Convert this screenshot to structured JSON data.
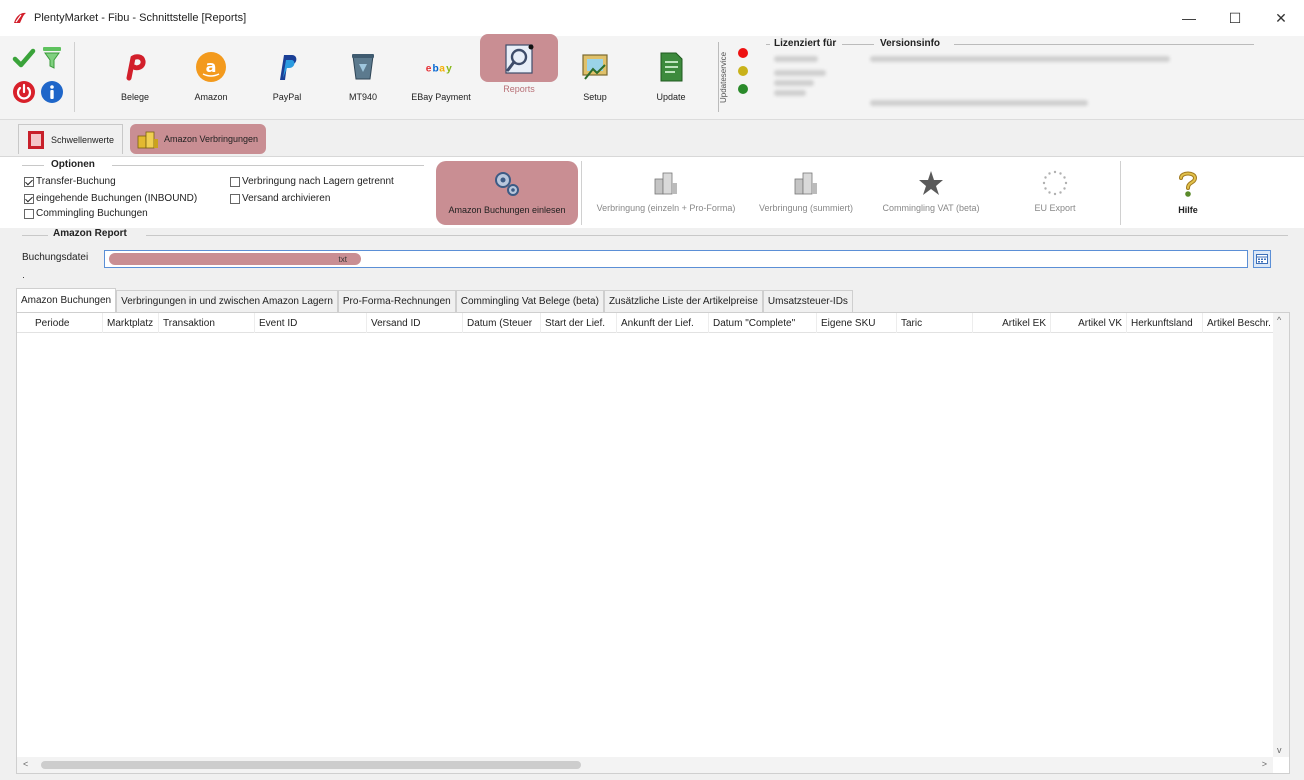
{
  "window": {
    "title": "PlentyMarket - Fibu - Schnittstelle [Reports]",
    "controls": {
      "minimize": "—",
      "maximize": "☐",
      "close": "✕"
    }
  },
  "toolbar": {
    "buttons": [
      {
        "label": "Belege",
        "icon": "plenty-p-icon"
      },
      {
        "label": "Amazon",
        "icon": "amazon-icon"
      },
      {
        "label": "PayPal",
        "icon": "paypal-icon"
      },
      {
        "label": "MT940",
        "icon": "bank-bin-icon"
      },
      {
        "label": "EBay Payment",
        "icon": "ebay-icon"
      },
      {
        "label": "Reports",
        "icon": "reports-icon",
        "active": true
      },
      {
        "label": "Setup",
        "icon": "setup-icon"
      },
      {
        "label": "Update",
        "icon": "update-icon"
      }
    ],
    "status_label": "Updateservice",
    "licensed_label": "Lizenziert für",
    "version_label": "Versionsinfo"
  },
  "main_tabs": [
    {
      "label": "Schwellenwerte",
      "icon": "threshold-icon"
    },
    {
      "label": "Amazon Verbringungen",
      "icon": "warehouse-icon",
      "active": true
    }
  ],
  "options": {
    "title": "Optionen",
    "checkboxes": [
      {
        "label": "Transfer-Buchung",
        "checked": true
      },
      {
        "label": "eingehende Buchungen (INBOUND)",
        "checked": true
      },
      {
        "label": "Commingling Buchungen",
        "checked": false
      },
      {
        "label": "Verbringung nach Lagern getrennt",
        "checked": false
      },
      {
        "label": "Versand archivieren",
        "checked": false
      }
    ]
  },
  "actions": [
    {
      "label": "Amazon Buchungen einlesen",
      "icon": "gears-icon",
      "active": true
    },
    {
      "label": "Verbringung (einzeln + Pro-Forma)",
      "icon": "building-icon"
    },
    {
      "label": "Verbringung (summiert)",
      "icon": "building-icon"
    },
    {
      "label": "Commingling VAT (beta)",
      "icon": "star-icon"
    },
    {
      "label": "EU Export",
      "icon": "eu-stars-icon"
    },
    {
      "label": "Hilfe",
      "icon": "help-icon"
    }
  ],
  "report": {
    "title": "Amazon Report",
    "file_label": "Buchungsdatei",
    "file_value": "txt"
  },
  "sub_tabs": [
    "Amazon Buchungen",
    "Verbringungen in und zwischen Amazon Lagern",
    "Pro-Forma-Rechnungen",
    "Commingling Vat Belege (beta)",
    "Zusätzliche Liste der Artikelpreise",
    "Umsatzsteuer-IDs"
  ],
  "grid": {
    "columns": [
      "Periode",
      "Marktplatz",
      "Transaktion",
      "Event ID",
      "Versand ID",
      "Datum (Steuer",
      "Start der Lief.",
      "Ankunft der Lief.",
      "Datum \"Complete\"",
      "Eigene SKU",
      "Taric",
      "Artikel EK",
      "Artikel VK",
      "Herkunftsland",
      "Artikel Beschr."
    ]
  }
}
